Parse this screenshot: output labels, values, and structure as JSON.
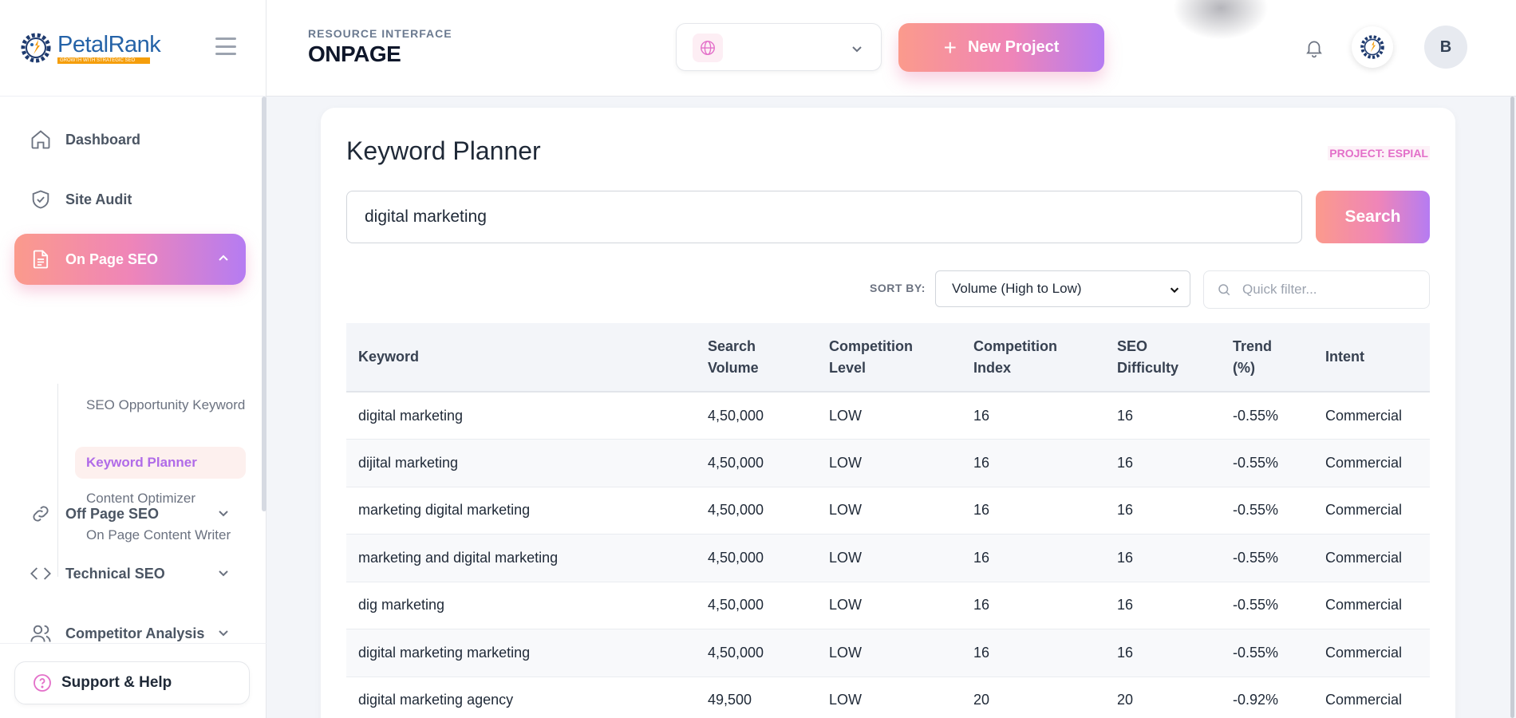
{
  "brand": {
    "name": "PetalRank",
    "tagline": "GROWTH WITH STRATEGIC SEO"
  },
  "sidebar": {
    "items": [
      {
        "label": "Dashboard",
        "icon": "home-icon"
      },
      {
        "label": "Site Audit",
        "icon": "shield-check-icon"
      },
      {
        "label": "On Page SEO",
        "icon": "document-icon",
        "expanded": true
      },
      {
        "label": "Off Page SEO",
        "icon": "link-icon"
      },
      {
        "label": "Technical SEO",
        "icon": "code-icon"
      },
      {
        "label": "Competitor Analysis",
        "icon": "users-icon"
      }
    ],
    "sub_items": [
      {
        "label": "SEO Opportunity Keyword"
      },
      {
        "label": "Keyword Planner",
        "active": true
      },
      {
        "label": "Content Optimizer"
      },
      {
        "label": "On Page Content Writer"
      }
    ],
    "support": "Support & Help"
  },
  "header": {
    "label": "RESOURCE INTERFACE",
    "title": "ONPAGE",
    "new_project": "New Project",
    "user_initial": "B"
  },
  "main": {
    "title": "Keyword Planner",
    "project_tag": "PROJECT: ESPIAL",
    "search_value": "digital marketing",
    "search_button": "Search",
    "sort_label": "SORT BY:",
    "sort_value": "Volume (High to Low)",
    "filter_placeholder": "Quick filter...",
    "columns": [
      "Keyword",
      "Search Volume",
      "Competition Level",
      "Competition Index",
      "SEO Difficulty",
      "Trend (%)",
      "Intent"
    ],
    "rows": [
      [
        "digital marketing",
        "4,50,000",
        "LOW",
        "16",
        "16",
        "-0.55%",
        "Commercial"
      ],
      [
        "dijital marketing",
        "4,50,000",
        "LOW",
        "16",
        "16",
        "-0.55%",
        "Commercial"
      ],
      [
        "marketing digital marketing",
        "4,50,000",
        "LOW",
        "16",
        "16",
        "-0.55%",
        "Commercial"
      ],
      [
        "marketing and digital marketing",
        "4,50,000",
        "LOW",
        "16",
        "16",
        "-0.55%",
        "Commercial"
      ],
      [
        "dig marketing",
        "4,50,000",
        "LOW",
        "16",
        "16",
        "-0.55%",
        "Commercial"
      ],
      [
        "digital marketing marketing",
        "4,50,000",
        "LOW",
        "16",
        "16",
        "-0.55%",
        "Commercial"
      ],
      [
        "digital marketing agency",
        "49,500",
        "LOW",
        "20",
        "20",
        "-0.92%",
        "Commercial"
      ]
    ]
  },
  "colors": {
    "accent_start": "#fb9a8c",
    "accent_mid": "#ef85b8",
    "accent_end": "#b57cf2",
    "brand_blue": "#2563a8"
  }
}
